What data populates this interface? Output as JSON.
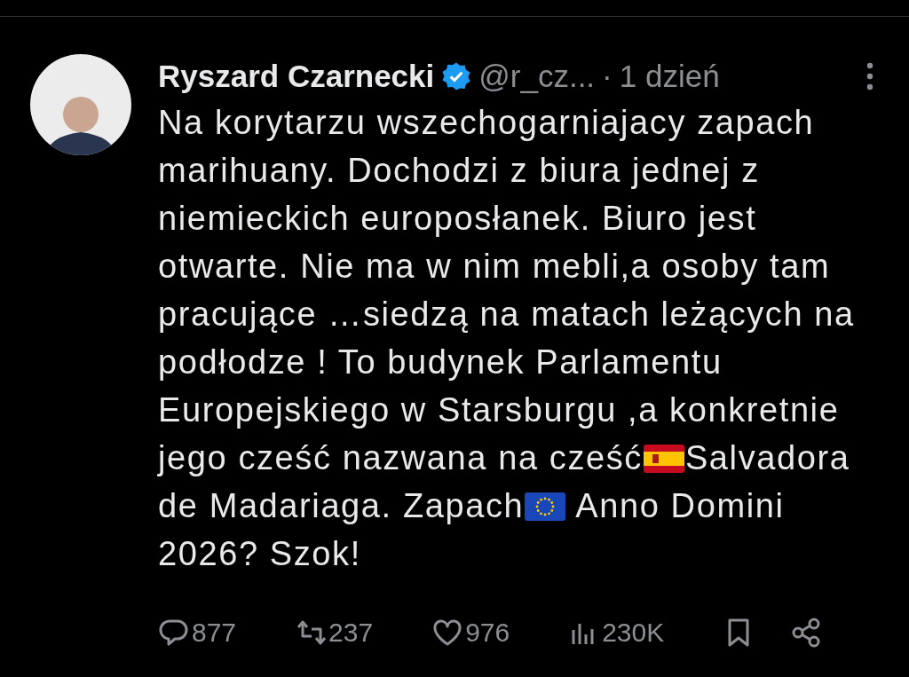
{
  "tweet": {
    "author": {
      "name": "Ryszard Czarnecki",
      "verified": true,
      "handle": "@r_cz...",
      "separator": "·",
      "time": "1 dzień"
    },
    "body": [
      {
        "kind": "text",
        "text": "Na korytarzu wszechogarniajacy zapach marihuany. Dochodzi z biura jednej z niemieckich europosłanek. Biuro jest otwarte. Nie ma w nim mebli,a osoby tam pracujące …siedzą na matach leżących na podłodze ! To budynek Parlamentu Europejskiego w Starsburgu ,a konkretnie jego cześć nazwana na cześć"
      },
      {
        "kind": "flag-spain"
      },
      {
        "kind": "text",
        "text": "Salvadora de Madariaga. Zapach"
      },
      {
        "kind": "flag-eu"
      },
      {
        "kind": "text",
        "text": " Anno Domini 2026? Szok!"
      }
    ],
    "actions": [
      {
        "kind": "reply",
        "count": "877"
      },
      {
        "kind": "retweet",
        "count": "237"
      },
      {
        "kind": "like",
        "count": "976"
      },
      {
        "kind": "views",
        "count": "230K"
      },
      {
        "kind": "bookmark"
      },
      {
        "kind": "share"
      }
    ]
  }
}
